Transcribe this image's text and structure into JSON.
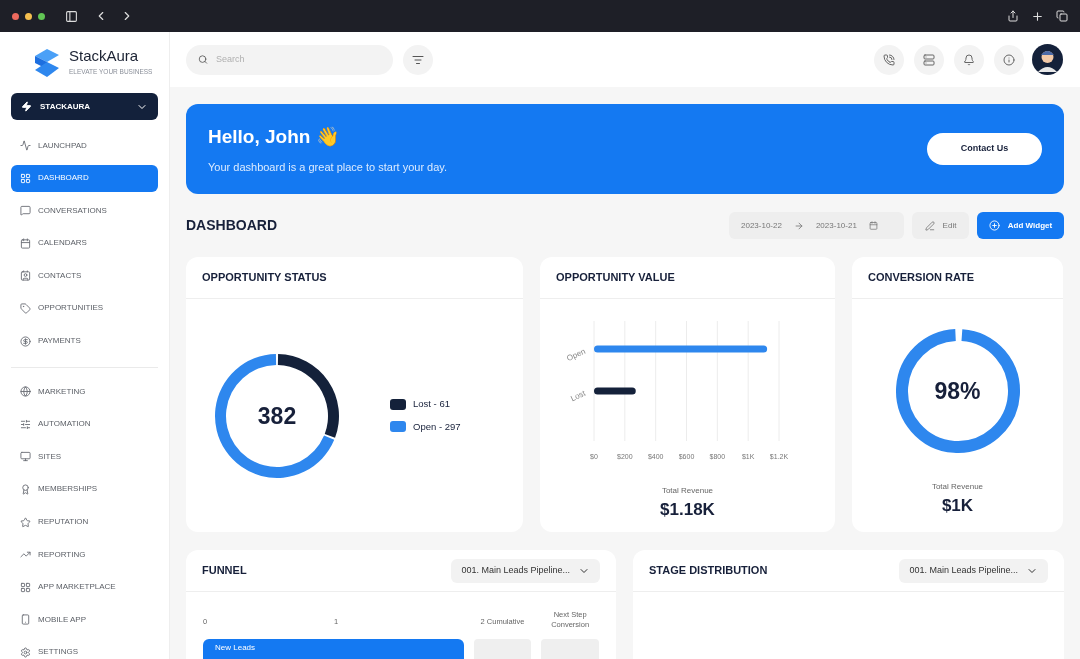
{
  "brand": {
    "name": "StackAura",
    "tagline": "ELEVATE YOUR BUSINESS"
  },
  "workspace": {
    "label": "STACKAURA"
  },
  "sidebar": {
    "sections": [
      {
        "items": [
          {
            "label": "LAUNCHPAD",
            "selected": false
          },
          {
            "label": "DASHBOARD",
            "selected": true
          },
          {
            "label": "CONVERSATIONS",
            "selected": false
          },
          {
            "label": "CALENDARS",
            "selected": false
          },
          {
            "label": "CONTACTS",
            "selected": false
          },
          {
            "label": "OPPORTUNITIES",
            "selected": false
          },
          {
            "label": "PAYMENTS",
            "selected": false
          }
        ]
      },
      {
        "items": [
          {
            "label": "MARKETING",
            "selected": false
          },
          {
            "label": "AUTOMATION",
            "selected": false
          },
          {
            "label": "SITES",
            "selected": false
          },
          {
            "label": "MEMBERSHIPS",
            "selected": false
          },
          {
            "label": "REPUTATION",
            "selected": false
          },
          {
            "label": "REPORTING",
            "selected": false
          },
          {
            "label": "APP MARKETPLACE",
            "selected": false
          },
          {
            "label": "MOBILE APP",
            "selected": false
          },
          {
            "label": "SETTINGS",
            "selected": false
          }
        ]
      }
    ]
  },
  "search": {
    "placeholder": "Search"
  },
  "banner": {
    "greeting": "Hello, John 👋",
    "subtitle": "Your dashboard is a great place to start your day.",
    "button": "Contact Us"
  },
  "dashboard": {
    "title": "DASHBOARD",
    "date_from": "2023-10-22",
    "date_to": "2023-10-21",
    "edit_button": "Edit",
    "add_button": "Add Widget"
  },
  "opportunity_status": {
    "title": "OPPORTUNITY STATUS",
    "total": "382",
    "legend": [
      {
        "color": "#14213a"
      },
      {
        "color": "#2e87ee"
      }
    ],
    "chart_data": {
      "type": "donut",
      "legend": "right",
      "categories": [
        "Lost - 61",
        "Open - 297"
      ],
      "series": [
        {
          "values": [
            31,
            69
          ]
        }
      ]
    }
  },
  "opportunity_value": {
    "title": "OPPORTUNITY VALUE",
    "total_label": "Total Revenue",
    "total": "$1.18K",
    "chart_data": {
      "type": "bar",
      "orientation": "horizontal",
      "stacked": false,
      "grid": true,
      "categories": [
        "Open",
        "Lost"
      ],
      "series": [
        {
          "color": "#2e87ee",
          "values": [
            1123,
            null
          ]
        },
        {
          "color": "#14213a",
          "values": [
            null,
            271
          ]
        }
      ],
      "xlim": [
        0,
        1200
      ],
      "xticks": [
        {
          "value": 0,
          "label": "$0"
        },
        {
          "value": 200,
          "label": "$200"
        },
        {
          "value": 400,
          "label": "$400"
        },
        {
          "value": 600,
          "label": "$600"
        },
        {
          "value": 800,
          "label": "$800"
        },
        {
          "value": 1000,
          "label": "$1K"
        },
        {
          "value": 1200,
          "label": "$1.2K"
        }
      ]
    }
  },
  "conversion_rate": {
    "title": "CONVERSION RATE",
    "level": 0.98,
    "reading": "98%",
    "total_label": "Total Revenue",
    "total": "$1K"
  },
  "funnel": {
    "title": "FUNNEL",
    "pipeline": "001. Main Leads Pipeline...",
    "columns": [
      "0",
      "1",
      "2 Cumulative",
      "Next Step Conversion"
    ],
    "bar_label": "New Leads"
  },
  "stage_distribution": {
    "title": "STAGE DISTRIBUTION",
    "pipeline": "001. Main Leads Pipeline..."
  }
}
